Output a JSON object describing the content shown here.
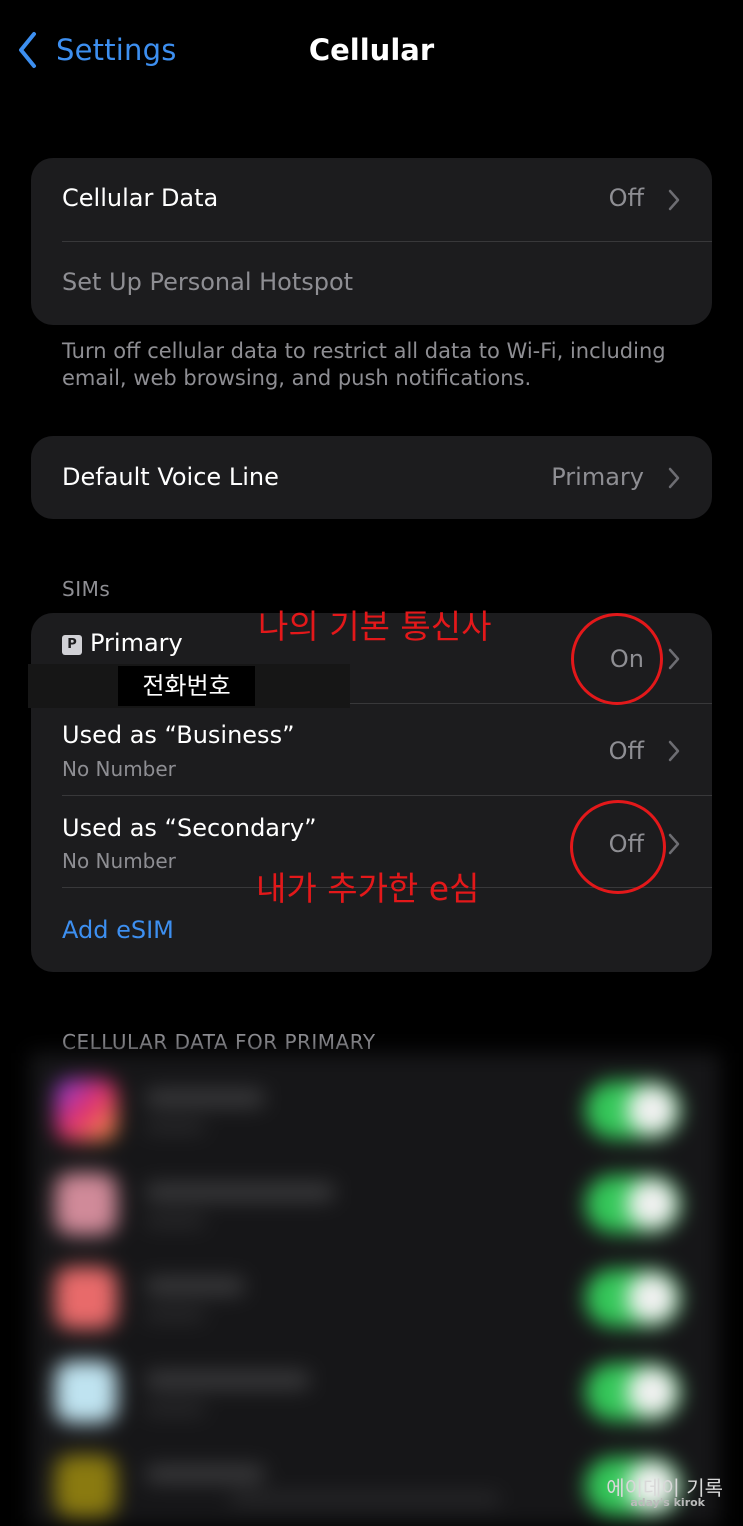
{
  "nav": {
    "back_label": "Settings",
    "title": "Cellular"
  },
  "group1": {
    "cellular_data": {
      "label": "Cellular Data",
      "value": "Off"
    },
    "hotspot": {
      "label": "Set Up Personal Hotspot"
    }
  },
  "footnote": "Turn off cellular data to restrict all data to Wi-Fi, including email, web browsing, and push notifications.",
  "voice": {
    "label": "Default Voice Line",
    "value": "Primary"
  },
  "sims": {
    "header": "SIMs",
    "primary": {
      "badge": "P",
      "label": "Primary",
      "value": "On",
      "redacted_note": "전화번호"
    },
    "business": {
      "label": "Used as “Business”",
      "sub": "No Number",
      "value": "Off"
    },
    "secondary": {
      "label": "Used as “Secondary”",
      "sub": "No Number",
      "value": "Off"
    },
    "add_esim": "Add eSIM"
  },
  "annotations": {
    "primary_note": "나의 기본 통신사",
    "secondary_note": "내가 추가한 e심",
    "color": "#e3181a"
  },
  "cellular_section_header": "CELLULAR DATA FOR PRIMARY",
  "app_list": {
    "blurred": true,
    "icon_colors": [
      "#c23a8f",
      "#d08a99",
      "#e86a6a",
      "#bfe3f0",
      "#8a7a10"
    ],
    "toggle_color": "#34c759"
  },
  "watermark": {
    "line1": "에이데이 기록",
    "line2": "aday's kirok"
  },
  "colors": {
    "accent": "#3d8ff0",
    "card": "#1c1c1e",
    "secondary_text": "#8e8e93"
  }
}
